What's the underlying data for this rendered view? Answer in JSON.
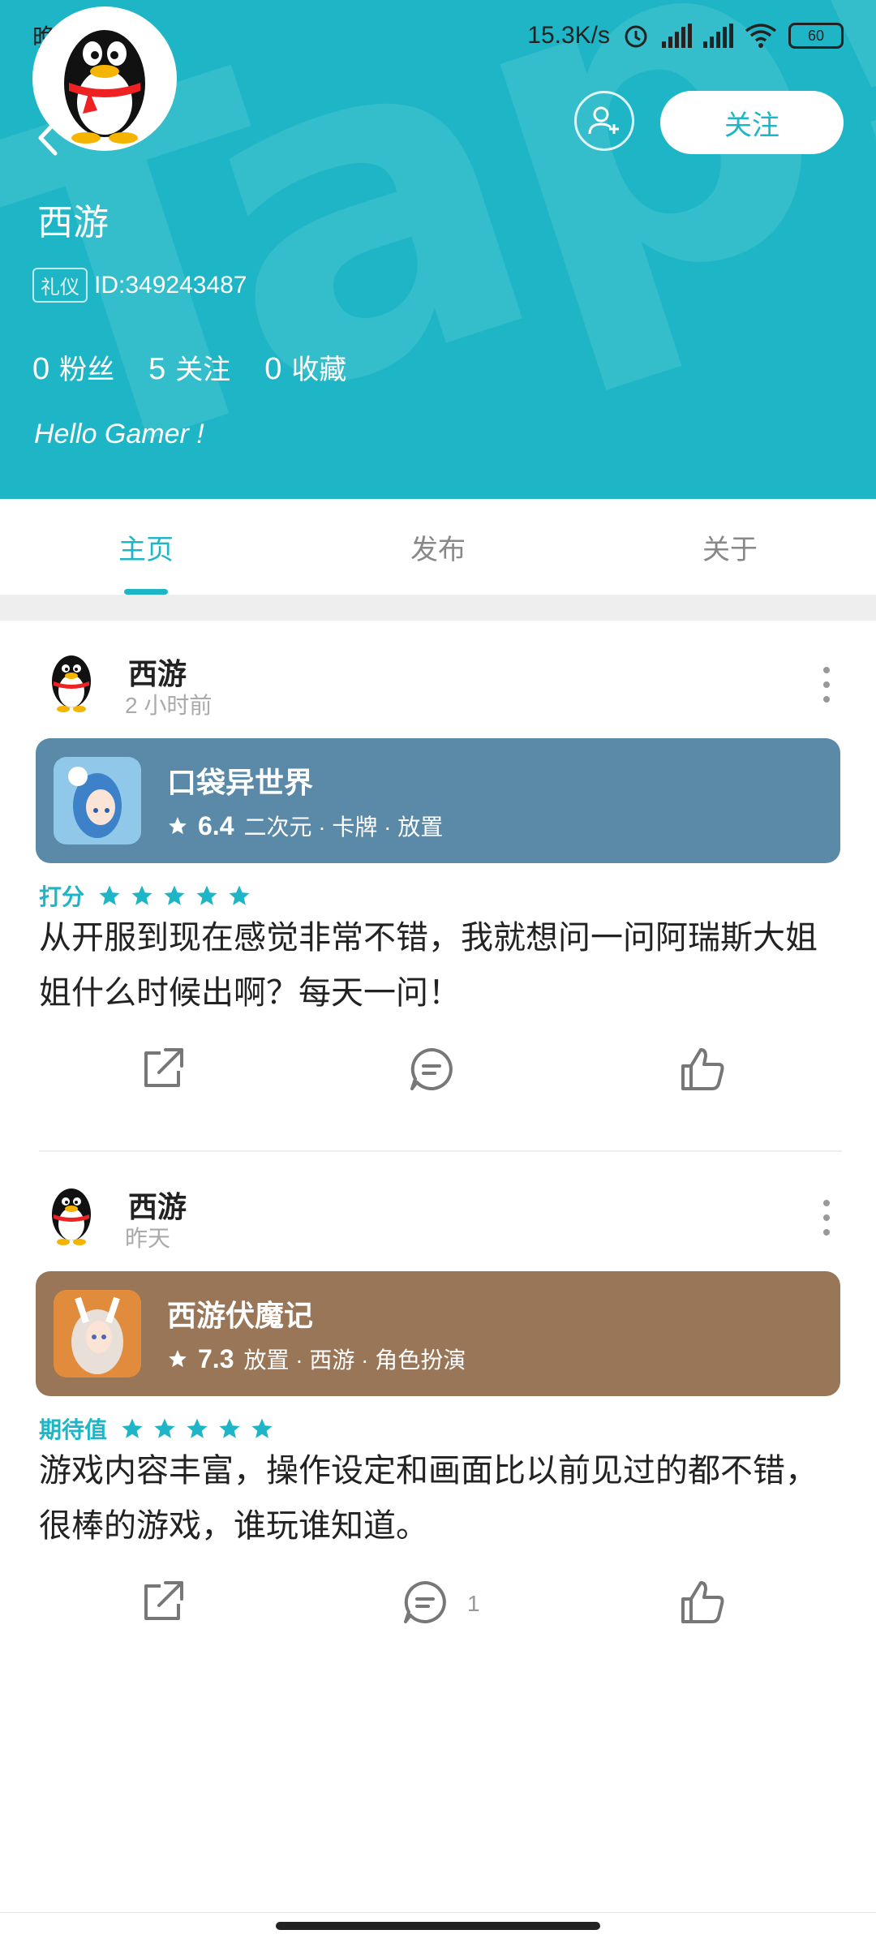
{
  "status": {
    "time": "晚上",
    "net_speed": "15.3K/s",
    "battery": "60"
  },
  "header": {
    "bg_text": "Tap!",
    "follow_label": "关注",
    "name": "西游",
    "badge": "礼仪",
    "id_text": "ID:349243487",
    "stats": [
      {
        "num": "0",
        "label": "粉丝"
      },
      {
        "num": "5",
        "label": "关注"
      },
      {
        "num": "0",
        "label": "收藏"
      }
    ],
    "bio": "Hello Gamer !"
  },
  "colors": {
    "accent": "#1eb6c6",
    "card1": "#5a8aa8",
    "card2": "#9a7658"
  },
  "tabs": [
    {
      "label": "主页",
      "active": true
    },
    {
      "label": "发布",
      "active": false
    },
    {
      "label": "关于",
      "active": false
    }
  ],
  "posts": [
    {
      "author": "西游",
      "time": "2 小时前",
      "game": {
        "name": "口袋异世界",
        "score": "6.4",
        "tags": "二次元 · 卡牌 · 放置"
      },
      "rating_label": "打分",
      "stars": 5,
      "text": "从开服到现在感觉非常不错，我就想问一问阿瑞斯大姐姐什么时候出啊？每天一问！",
      "comment_count": ""
    },
    {
      "author": "西游",
      "time": "昨天",
      "game": {
        "name": "西游伏魔记",
        "score": "7.3",
        "tags": "放置 · 西游 · 角色扮演"
      },
      "rating_label": "期待值",
      "stars": 5,
      "text": "游戏内容丰富，操作设定和画面比以前见过的都不错，很棒的游戏，谁玩谁知道。",
      "comment_count": "1"
    }
  ]
}
